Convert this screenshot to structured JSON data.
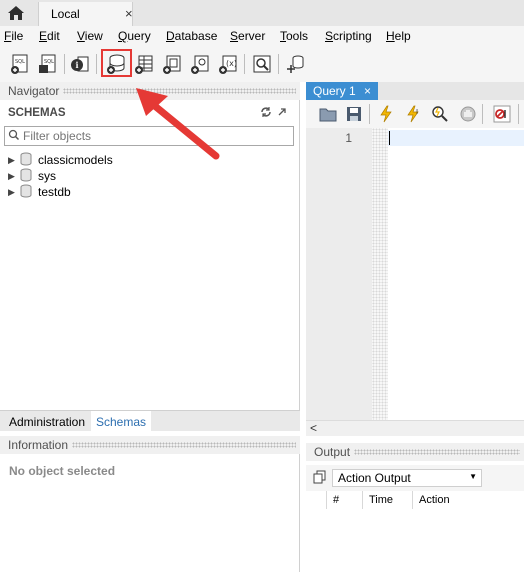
{
  "app": {
    "connection_tab": "Local",
    "close_glyph": "×"
  },
  "menu": {
    "items": [
      {
        "label": "File",
        "mnemonic": "F",
        "rest": "ile"
      },
      {
        "label": "Edit",
        "mnemonic": "E",
        "rest": "dit"
      },
      {
        "label": "View",
        "mnemonic": "V",
        "rest": "iew"
      },
      {
        "label": "Query",
        "mnemonic": "Q",
        "rest": "uery"
      },
      {
        "label": "Database",
        "mnemonic": "D",
        "rest": "atabase"
      },
      {
        "label": "Server",
        "mnemonic": "S",
        "rest": "erver"
      },
      {
        "label": "Tools",
        "mnemonic": "T",
        "rest": "ools"
      },
      {
        "label": "Scripting",
        "mnemonic": "S",
        "rest": "cripting"
      },
      {
        "label": "Help",
        "mnemonic": "H",
        "rest": "elp"
      }
    ]
  },
  "toolbar": {
    "icons": [
      "new-sql-tab-icon",
      "open-sql-script-icon",
      "inspector-icon",
      "create-schema-icon",
      "create-table-icon",
      "create-view-icon",
      "create-procedure-icon",
      "create-function-icon",
      "search-table-data-icon",
      "reconnect-icon"
    ],
    "highlighted": "create-schema-icon",
    "highlight_color": "#e53935",
    "sql_label": "SQL"
  },
  "navigator": {
    "title": "Navigator",
    "schemas_label": "SCHEMAS",
    "filter_placeholder": "Filter objects",
    "schemas": [
      "classicmodels",
      "sys",
      "testdb"
    ]
  },
  "left_tabs": {
    "administration": "Administration",
    "schemas": "Schemas"
  },
  "information": {
    "title": "Information",
    "empty_text": "No object selected"
  },
  "query": {
    "tab_label": "Query 1",
    "line_number": "1",
    "accent": "#3c8ed2"
  },
  "output": {
    "title": "Output",
    "selector": "Action Output",
    "columns": [
      "#",
      "Time",
      "Action"
    ]
  }
}
